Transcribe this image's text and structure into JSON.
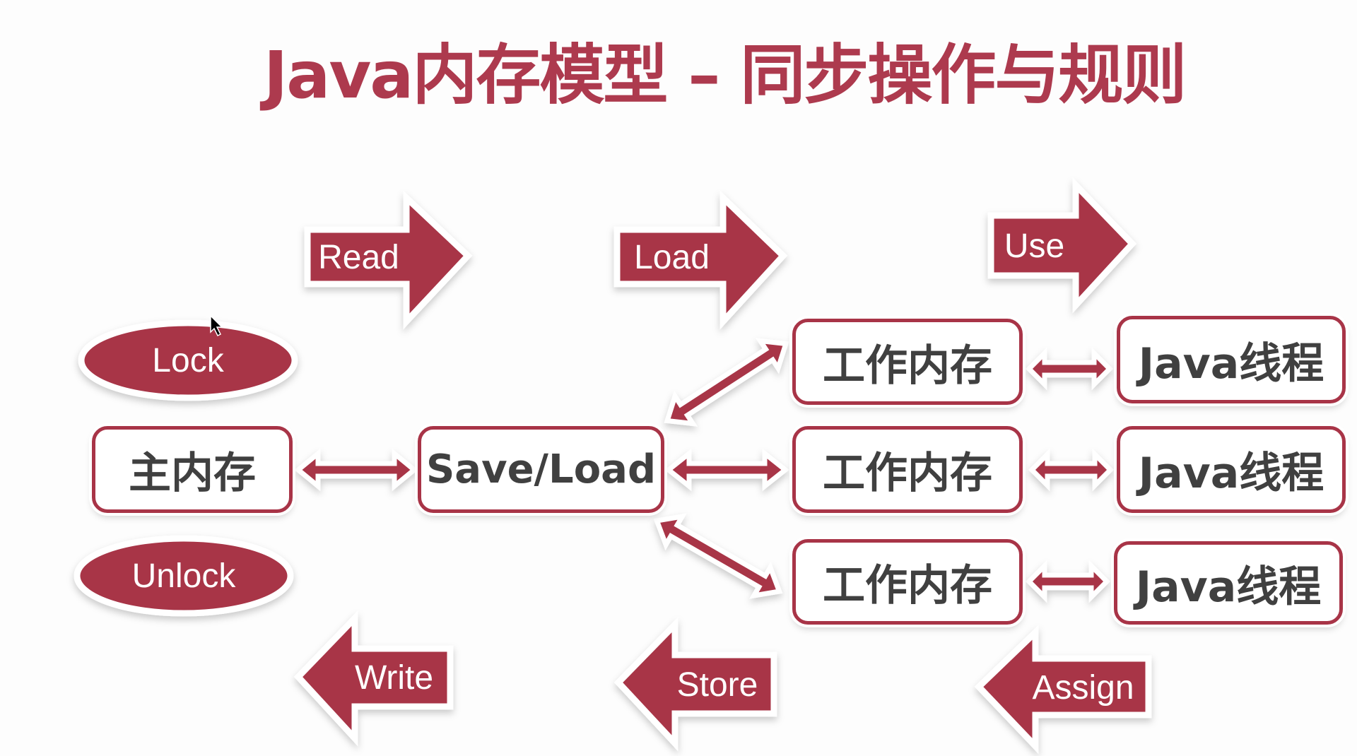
{
  "title": "Java内存模型 – 同步操作与规则",
  "colors": {
    "accent": "#a83447",
    "text": "#404040",
    "background": "#fdfdfd"
  },
  "operations": {
    "read": "Read",
    "load": "Load",
    "use": "Use",
    "write": "Write",
    "store": "Store",
    "assign": "Assign",
    "lock": "Lock",
    "unlock": "Unlock"
  },
  "nodes": {
    "main_memory": "主内存",
    "save_load": "Save/Load",
    "working_memory": [
      "工作内存",
      "工作内存",
      "工作内存"
    ],
    "java_thread": [
      "Java线程",
      "Java线程",
      "Java线程"
    ]
  },
  "cursor": "mouse-pointer"
}
